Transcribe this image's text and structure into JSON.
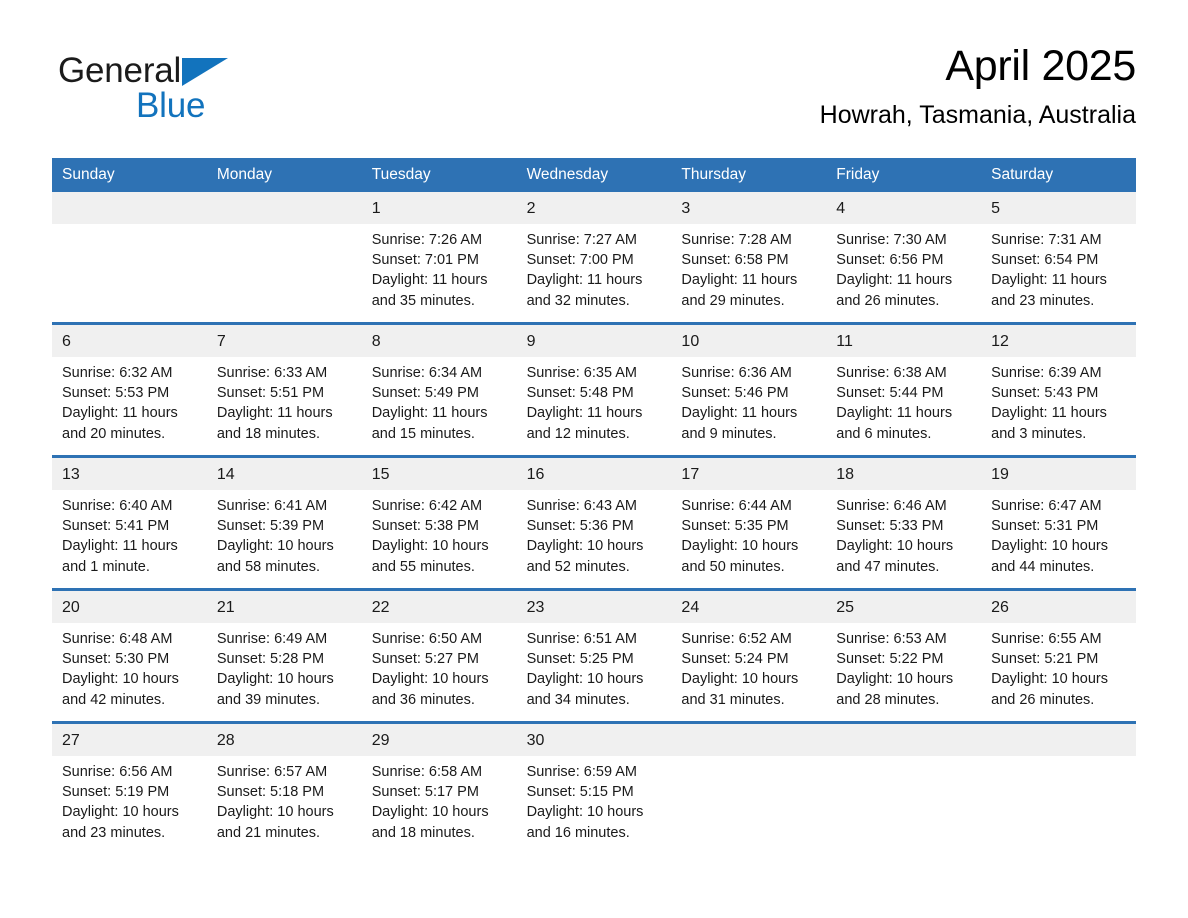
{
  "brand": {
    "word1": "General",
    "word2": "Blue",
    "triangle_color": "#1273bd",
    "text_color": "#1b1b1b"
  },
  "header": {
    "month_title": "April 2025",
    "location": "Howrah, Tasmania, Australia"
  },
  "theme": {
    "header_blue": "#2e72b4",
    "daynum_band": "#f0f0f0",
    "cell_bg": "#ffffff",
    "text": "#1a1a1a"
  },
  "calendar": {
    "weekdays": [
      "Sunday",
      "Monday",
      "Tuesday",
      "Wednesday",
      "Thursday",
      "Friday",
      "Saturday"
    ],
    "weeks": [
      {
        "days": [
          {
            "num": "",
            "info": ""
          },
          {
            "num": "",
            "info": ""
          },
          {
            "num": "1",
            "info": "Sunrise: 7:26 AM\nSunset: 7:01 PM\nDaylight: 11 hours\nand 35 minutes."
          },
          {
            "num": "2",
            "info": "Sunrise: 7:27 AM\nSunset: 7:00 PM\nDaylight: 11 hours\nand 32 minutes."
          },
          {
            "num": "3",
            "info": "Sunrise: 7:28 AM\nSunset: 6:58 PM\nDaylight: 11 hours\nand 29 minutes."
          },
          {
            "num": "4",
            "info": "Sunrise: 7:30 AM\nSunset: 6:56 PM\nDaylight: 11 hours\nand 26 minutes."
          },
          {
            "num": "5",
            "info": "Sunrise: 7:31 AM\nSunset: 6:54 PM\nDaylight: 11 hours\nand 23 minutes."
          }
        ]
      },
      {
        "days": [
          {
            "num": "6",
            "info": "Sunrise: 6:32 AM\nSunset: 5:53 PM\nDaylight: 11 hours\nand 20 minutes."
          },
          {
            "num": "7",
            "info": "Sunrise: 6:33 AM\nSunset: 5:51 PM\nDaylight: 11 hours\nand 18 minutes."
          },
          {
            "num": "8",
            "info": "Sunrise: 6:34 AM\nSunset: 5:49 PM\nDaylight: 11 hours\nand 15 minutes."
          },
          {
            "num": "9",
            "info": "Sunrise: 6:35 AM\nSunset: 5:48 PM\nDaylight: 11 hours\nand 12 minutes."
          },
          {
            "num": "10",
            "info": "Sunrise: 6:36 AM\nSunset: 5:46 PM\nDaylight: 11 hours\nand 9 minutes."
          },
          {
            "num": "11",
            "info": "Sunrise: 6:38 AM\nSunset: 5:44 PM\nDaylight: 11 hours\nand 6 minutes."
          },
          {
            "num": "12",
            "info": "Sunrise: 6:39 AM\nSunset: 5:43 PM\nDaylight: 11 hours\nand 3 minutes."
          }
        ]
      },
      {
        "days": [
          {
            "num": "13",
            "info": "Sunrise: 6:40 AM\nSunset: 5:41 PM\nDaylight: 11 hours\nand 1 minute."
          },
          {
            "num": "14",
            "info": "Sunrise: 6:41 AM\nSunset: 5:39 PM\nDaylight: 10 hours\nand 58 minutes."
          },
          {
            "num": "15",
            "info": "Sunrise: 6:42 AM\nSunset: 5:38 PM\nDaylight: 10 hours\nand 55 minutes."
          },
          {
            "num": "16",
            "info": "Sunrise: 6:43 AM\nSunset: 5:36 PM\nDaylight: 10 hours\nand 52 minutes."
          },
          {
            "num": "17",
            "info": "Sunrise: 6:44 AM\nSunset: 5:35 PM\nDaylight: 10 hours\nand 50 minutes."
          },
          {
            "num": "18",
            "info": "Sunrise: 6:46 AM\nSunset: 5:33 PM\nDaylight: 10 hours\nand 47 minutes."
          },
          {
            "num": "19",
            "info": "Sunrise: 6:47 AM\nSunset: 5:31 PM\nDaylight: 10 hours\nand 44 minutes."
          }
        ]
      },
      {
        "days": [
          {
            "num": "20",
            "info": "Sunrise: 6:48 AM\nSunset: 5:30 PM\nDaylight: 10 hours\nand 42 minutes."
          },
          {
            "num": "21",
            "info": "Sunrise: 6:49 AM\nSunset: 5:28 PM\nDaylight: 10 hours\nand 39 minutes."
          },
          {
            "num": "22",
            "info": "Sunrise: 6:50 AM\nSunset: 5:27 PM\nDaylight: 10 hours\nand 36 minutes."
          },
          {
            "num": "23",
            "info": "Sunrise: 6:51 AM\nSunset: 5:25 PM\nDaylight: 10 hours\nand 34 minutes."
          },
          {
            "num": "24",
            "info": "Sunrise: 6:52 AM\nSunset: 5:24 PM\nDaylight: 10 hours\nand 31 minutes."
          },
          {
            "num": "25",
            "info": "Sunrise: 6:53 AM\nSunset: 5:22 PM\nDaylight: 10 hours\nand 28 minutes."
          },
          {
            "num": "26",
            "info": "Sunrise: 6:55 AM\nSunset: 5:21 PM\nDaylight: 10 hours\nand 26 minutes."
          }
        ]
      },
      {
        "days": [
          {
            "num": "27",
            "info": "Sunrise: 6:56 AM\nSunset: 5:19 PM\nDaylight: 10 hours\nand 23 minutes."
          },
          {
            "num": "28",
            "info": "Sunrise: 6:57 AM\nSunset: 5:18 PM\nDaylight: 10 hours\nand 21 minutes."
          },
          {
            "num": "29",
            "info": "Sunrise: 6:58 AM\nSunset: 5:17 PM\nDaylight: 10 hours\nand 18 minutes."
          },
          {
            "num": "30",
            "info": "Sunrise: 6:59 AM\nSunset: 5:15 PM\nDaylight: 10 hours\nand 16 minutes."
          },
          {
            "num": "",
            "info": ""
          },
          {
            "num": "",
            "info": ""
          },
          {
            "num": "",
            "info": ""
          }
        ]
      }
    ]
  }
}
